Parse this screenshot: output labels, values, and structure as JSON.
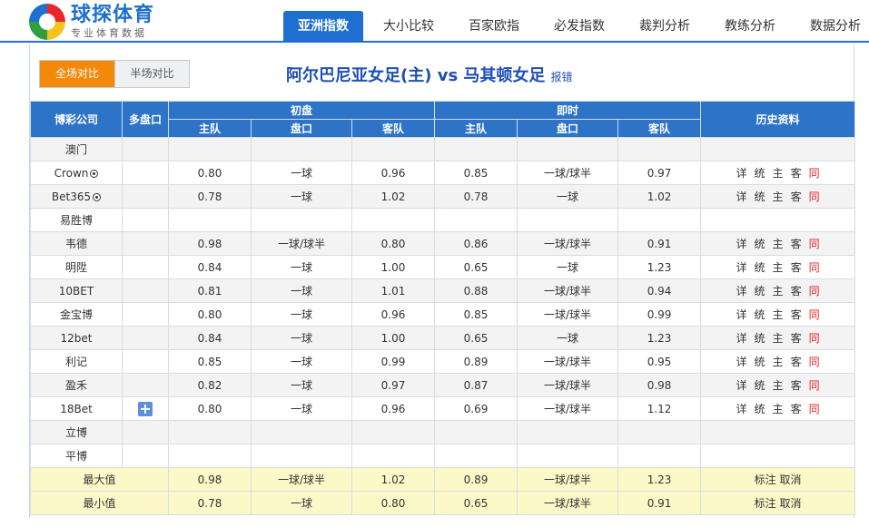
{
  "logo": {
    "main": "球探体育",
    "sub": "专业体育数据"
  },
  "nav": [
    "亚洲指数",
    "大小比较",
    "百家欧指",
    "必发指数",
    "裁判分析",
    "教练分析",
    "数据分析"
  ],
  "toggle": {
    "full": "全场对比",
    "half": "半场对比"
  },
  "match": {
    "title": "阿尔巴尼亚女足(主) vs 马其顿女足",
    "report": "报错"
  },
  "table": {
    "headers": {
      "company": "博彩公司",
      "multi": "多盘口",
      "initial": "初盘",
      "live": "即时",
      "history": "历史资料",
      "home": "主队",
      "handicap": "盘口",
      "away": "客队"
    },
    "rows": [
      {
        "company": "澳门",
        "ball": false,
        "plus": false,
        "values": [
          "",
          "",
          "",
          "",
          "",
          ""
        ],
        "hist": false
      },
      {
        "company": "Crown",
        "ball": true,
        "plus": false,
        "values": [
          "0.80",
          "一球",
          "0.96",
          "0.85",
          "一球/球半",
          "0.97"
        ],
        "hist": true
      },
      {
        "company": "Bet365",
        "ball": true,
        "plus": false,
        "values": [
          "0.78",
          "一球",
          "1.02",
          "0.78",
          "一球",
          "1.02"
        ],
        "hist": true
      },
      {
        "company": "易胜博",
        "ball": false,
        "plus": false,
        "values": [
          "",
          "",
          "",
          "",
          "",
          ""
        ],
        "hist": false
      },
      {
        "company": "韦德",
        "ball": false,
        "plus": false,
        "values": [
          "0.98",
          "一球/球半",
          "0.80",
          "0.86",
          "一球/球半",
          "0.91"
        ],
        "hist": true
      },
      {
        "company": "明陞",
        "ball": false,
        "plus": false,
        "values": [
          "0.84",
          "一球",
          "1.00",
          "0.65",
          "一球",
          "1.23"
        ],
        "hist": true
      },
      {
        "company": "10BET",
        "ball": false,
        "plus": false,
        "values": [
          "0.81",
          "一球",
          "1.01",
          "0.88",
          "一球/球半",
          "0.94"
        ],
        "hist": true
      },
      {
        "company": "金宝博",
        "ball": false,
        "plus": false,
        "values": [
          "0.80",
          "一球",
          "0.96",
          "0.85",
          "一球/球半",
          "0.99"
        ],
        "hist": true
      },
      {
        "company": "12bet",
        "ball": false,
        "plus": false,
        "values": [
          "0.84",
          "一球",
          "1.00",
          "0.65",
          "一球",
          "1.23"
        ],
        "hist": true
      },
      {
        "company": "利记",
        "ball": false,
        "plus": false,
        "values": [
          "0.85",
          "一球",
          "0.99",
          "0.89",
          "一球/球半",
          "0.95"
        ],
        "hist": true
      },
      {
        "company": "盈禾",
        "ball": false,
        "plus": false,
        "values": [
          "0.82",
          "一球",
          "0.97",
          "0.87",
          "一球/球半",
          "0.98"
        ],
        "hist": true
      },
      {
        "company": "18Bet",
        "ball": false,
        "plus": true,
        "values": [
          "0.80",
          "一球",
          "0.96",
          "0.69",
          "一球/球半",
          "1.12"
        ],
        "hist": true
      },
      {
        "company": "立博",
        "ball": false,
        "plus": false,
        "values": [
          "",
          "",
          "",
          "",
          "",
          ""
        ],
        "hist": false
      },
      {
        "company": "平博",
        "ball": false,
        "plus": false,
        "values": [
          "",
          "",
          "",
          "",
          "",
          ""
        ],
        "hist": false
      }
    ],
    "history_links": [
      "详",
      "统",
      "主",
      "客",
      "同"
    ],
    "summary": [
      {
        "label": "最大值",
        "values": [
          "0.98",
          "一球/球半",
          "1.02",
          "0.89",
          "一球/球半",
          "1.23"
        ]
      },
      {
        "label": "最小值",
        "values": [
          "0.78",
          "一球",
          "0.80",
          "0.65",
          "一球/球半",
          "0.91"
        ]
      }
    ],
    "summary_links": {
      "mark": "标注",
      "cancel": "取消"
    }
  },
  "colors": {
    "brand": "#1e6fcf",
    "header": "#2d73c8",
    "active_toggle": "#f2890a",
    "summary_bg": "#fdf8c8",
    "hist_red": "#e02020"
  }
}
